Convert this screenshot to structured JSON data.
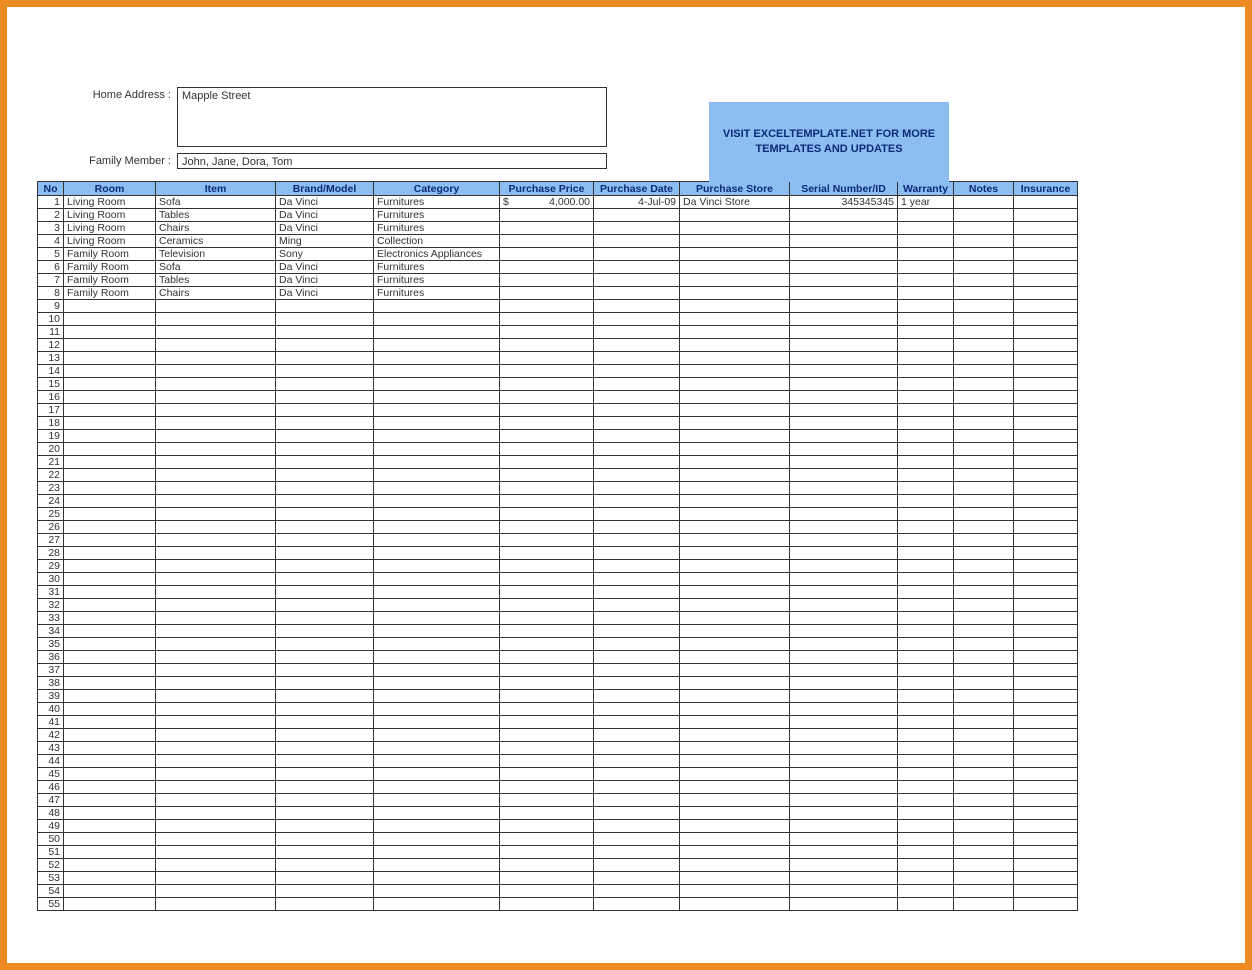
{
  "labels": {
    "home_address": "Home Address :",
    "family_member": "Family Member :"
  },
  "fields": {
    "home_address": "Mapple Street",
    "family_member": "John, Jane, Dora, Tom"
  },
  "promo": "VISIT EXCELTEMPLATE.NET FOR MORE TEMPLATES AND UPDATES",
  "columns": [
    "No",
    "Room",
    "Item",
    "Brand/Model",
    "Category",
    "Purchase Price",
    "Purchase Date",
    "Purchase Store",
    "Serial Number/ID",
    "Warranty",
    "Notes",
    "Insurance"
  ],
  "total_rows": 55,
  "rows": [
    {
      "no": "1",
      "room": "Living Room",
      "item": "Sofa",
      "brand": "Da Vinci",
      "category": "Furnitures",
      "price_currency": "$",
      "price_value": "4,000.00",
      "date": "4-Jul-09",
      "store": "Da Vinci Store",
      "serial": "345345345",
      "warranty": "1 year",
      "notes": "",
      "insurance": ""
    },
    {
      "no": "2",
      "room": "Living Room",
      "item": "Tables",
      "brand": "Da Vinci",
      "category": "Furnitures",
      "price_currency": "",
      "price_value": "",
      "date": "",
      "store": "",
      "serial": "",
      "warranty": "",
      "notes": "",
      "insurance": ""
    },
    {
      "no": "3",
      "room": "Living Room",
      "item": "Chairs",
      "brand": "Da Vinci",
      "category": "Furnitures",
      "price_currency": "",
      "price_value": "",
      "date": "",
      "store": "",
      "serial": "",
      "warranty": "",
      "notes": "",
      "insurance": ""
    },
    {
      "no": "4",
      "room": "Living Room",
      "item": "Ceramics",
      "brand": "Ming",
      "category": "Collection",
      "price_currency": "",
      "price_value": "",
      "date": "",
      "store": "",
      "serial": "",
      "warranty": "",
      "notes": "",
      "insurance": ""
    },
    {
      "no": "5",
      "room": "Family Room",
      "item": "Television",
      "brand": "Sony",
      "category": "Electronics Appliances",
      "price_currency": "",
      "price_value": "",
      "date": "",
      "store": "",
      "serial": "",
      "warranty": "",
      "notes": "",
      "insurance": ""
    },
    {
      "no": "6",
      "room": "Family Room",
      "item": "Sofa",
      "brand": "Da Vinci",
      "category": "Furnitures",
      "price_currency": "",
      "price_value": "",
      "date": "",
      "store": "",
      "serial": "",
      "warranty": "",
      "notes": "",
      "insurance": ""
    },
    {
      "no": "7",
      "room": "Family Room",
      "item": "Tables",
      "brand": "Da Vinci",
      "category": "Furnitures",
      "price_currency": "",
      "price_value": "",
      "date": "",
      "store": "",
      "serial": "",
      "warranty": "",
      "notes": "",
      "insurance": ""
    },
    {
      "no": "8",
      "room": "Family Room",
      "item": "Chairs",
      "brand": "Da Vinci",
      "category": "Furnitures",
      "price_currency": "",
      "price_value": "",
      "date": "",
      "store": "",
      "serial": "",
      "warranty": "",
      "notes": "",
      "insurance": ""
    }
  ]
}
